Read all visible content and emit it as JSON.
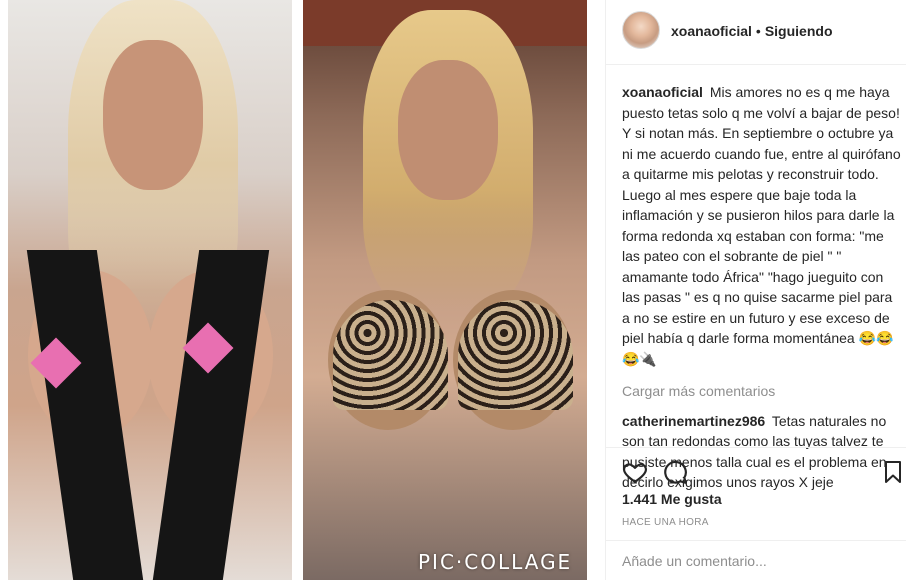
{
  "post": {
    "username": "xoanaoficial",
    "separator": "•",
    "follow_status": "Siguiendo",
    "watermark": "PIC·COLLAGE",
    "comments": [
      {
        "username": "xoanaoficial",
        "text": "Mis amores no es q me haya puesto tetas solo q me volví a bajar de peso! Y si notan más. En septiembre o octubre ya ni me acuerdo cuando fue, entre al quirófano a quitarme mis pelotas y reconstruir todo. Luego al mes espere que baje toda la inflamación y se pusieron hilos para darle la forma redonda xq estaban con forma: \"me las pateo con el sobrante de piel \" \" amamante todo África\" \"hago jueguito con las pasas \" es q no quise sacarme piel para a no se estire en un futuro y ese exceso de piel había q darle forma momentánea 😂😂😂🔌"
      },
      {
        "username": "catherinemartinez986",
        "text": "Tetas naturales no son tan redondas como las tuyas talvez te pusiste menos talla cual es el problema en decirlo exigimos unos rayos X jeje"
      }
    ],
    "load_more": "Cargar más comentarios",
    "likes": "1.441 Me gusta",
    "time": "HACE UNA HORA",
    "comment_placeholder": "Añade un comentario...",
    "icons": [
      "heart-icon",
      "comment-icon",
      "bookmark-icon"
    ]
  }
}
